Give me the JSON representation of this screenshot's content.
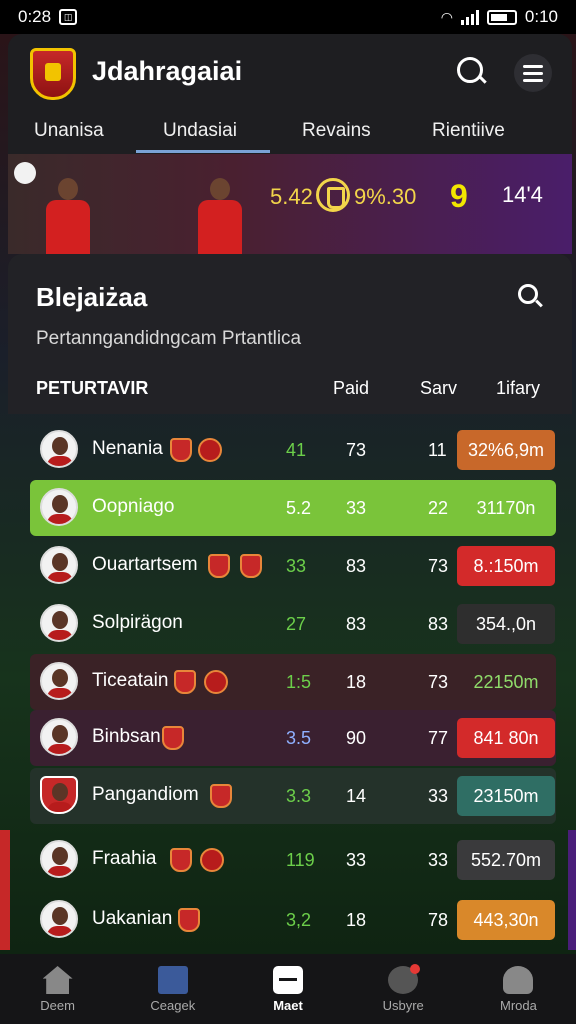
{
  "status_bar": {
    "time": "0:28",
    "battery_text": "0:10"
  },
  "header": {
    "title": "Jdahragaiai",
    "tabs": [
      {
        "label": "Unanisa"
      },
      {
        "label": "Undasiai",
        "active": true
      },
      {
        "label": "Revains"
      },
      {
        "label": "Rientiive"
      }
    ]
  },
  "banner": {
    "score_a": "5.42",
    "score_b": "9%.30",
    "score_c": "9",
    "score_d": "14'4"
  },
  "section": {
    "title": "Blejaiżaa",
    "subtitle": "Pertanngandidngcam Prtantlica",
    "columns": [
      "PETURTAVIR",
      "Paid",
      "Sarv",
      "1ifary"
    ]
  },
  "rows": [
    {
      "name": "Nenania",
      "v1": "41",
      "v2": "73",
      "v3": "11",
      "price": "32%6,9m",
      "price_color": "#c8682a",
      "row_bg": "transparent",
      "v1_color": "#6ccf4a"
    },
    {
      "name": "Oopniago",
      "v1": "5.2",
      "v2": "33",
      "v3": "22",
      "price": "31170n",
      "price_color": "transparent",
      "row_bg": "#7ac43a",
      "v1_color": "#ffffff"
    },
    {
      "name": "Ouartartsem",
      "v1": "33",
      "v2": "83",
      "v3": "73",
      "price": "8.:150m",
      "price_color": "#d32a2a",
      "row_bg": "transparent",
      "v1_color": "#6ccf4a"
    },
    {
      "name": "Solpirägon",
      "v1": "27",
      "v2": "83",
      "v3": "83",
      "price": "354.,0n",
      "price_color": "#2e2e2e",
      "row_bg": "transparent",
      "v1_color": "#6ccf4a"
    },
    {
      "name": "Ticeatain",
      "v1": "1:5",
      "v2": "18",
      "v3": "73",
      "price": "22150m",
      "price_color": "transparent",
      "row_bg": "#3a2226",
      "v1_color": "#6ccf4a"
    },
    {
      "name": "Binbsan",
      "v1": "3.5",
      "v2": "90",
      "v3": "77",
      "price": "841 80n",
      "price_color": "#d32a2a",
      "row_bg": "#3a2030",
      "v1_color": "#8fb0ff"
    },
    {
      "name": "Pangandiom",
      "v1": "3.3",
      "v2": "14",
      "v3": "33",
      "price": "23150m",
      "price_color": "#2f6e64",
      "row_bg": "#24322a",
      "v1_color": "#6ccf4a"
    },
    {
      "name": "Fraahia",
      "v1": "119",
      "v2": "33",
      "v3": "33",
      "price": "552.70m",
      "price_color": "#3a3a3c",
      "row_bg": "transparent",
      "v1_color": "#6ccf4a"
    },
    {
      "name": "Uakanian",
      "v1": "3,2",
      "v2": "18",
      "v3": "78",
      "price": "443,30n",
      "price_color": "#d9882a",
      "row_bg": "transparent",
      "v1_color": "#6ccf4a"
    }
  ],
  "bottom_nav": [
    {
      "label": "Deem"
    },
    {
      "label": "Ceagek"
    },
    {
      "label": "Maet",
      "active": true
    },
    {
      "label": "Usbyre"
    },
    {
      "label": "Mroda"
    }
  ]
}
